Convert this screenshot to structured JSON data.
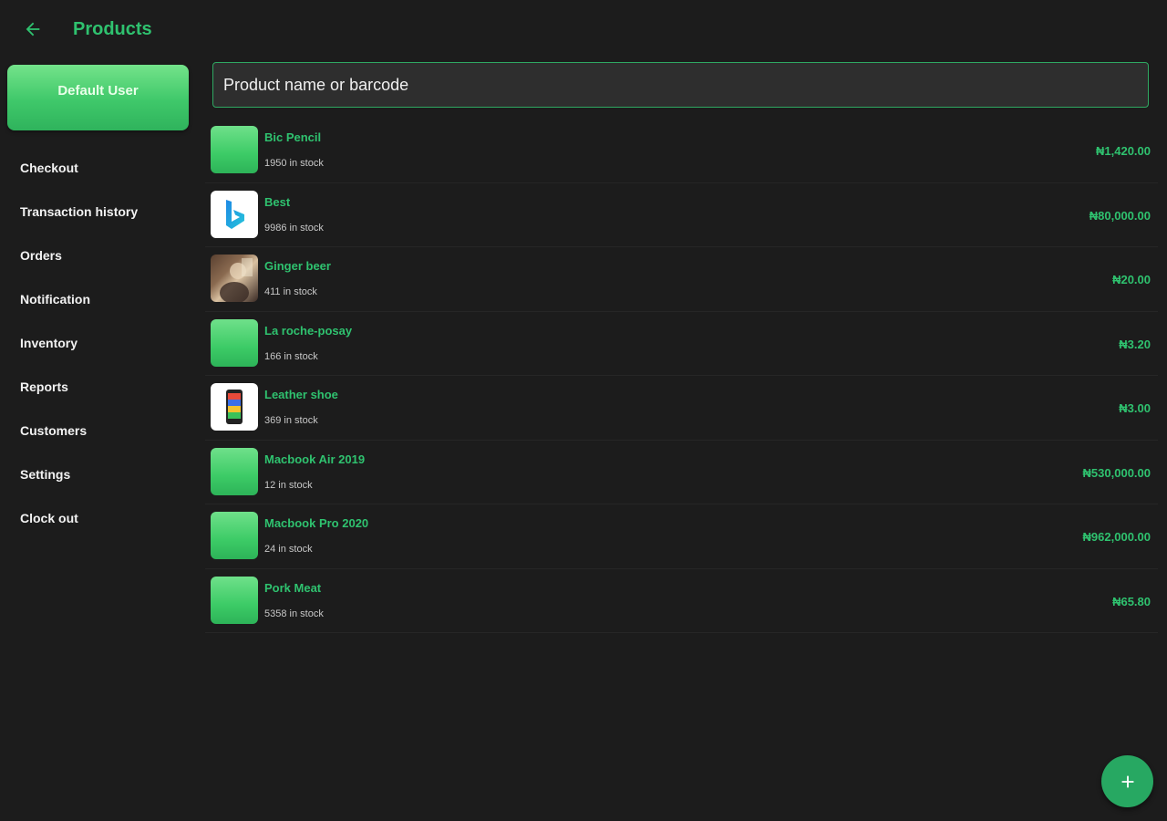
{
  "header": {
    "title": "Products",
    "back_icon": "arrow-left-icon",
    "accent_color": "#2fc26f"
  },
  "sidebar": {
    "user_label": "Default User",
    "items": [
      {
        "label": "Checkout"
      },
      {
        "label": "Transaction history"
      },
      {
        "label": "Orders"
      },
      {
        "label": "Notification"
      },
      {
        "label": "Inventory"
      },
      {
        "label": "Reports"
      },
      {
        "label": "Customers"
      },
      {
        "label": "Settings"
      },
      {
        "label": "Clock out"
      }
    ]
  },
  "search": {
    "placeholder": "Product name or barcode"
  },
  "products": [
    {
      "name": "Bic Pencil",
      "stock": "1950 in stock",
      "price": "₦1,420.00",
      "thumb": "green-placeholder"
    },
    {
      "name": "Best",
      "stock": "9986 in stock",
      "price": "₦80,000.00",
      "thumb": "bing-logo"
    },
    {
      "name": "Ginger beer",
      "stock": "411 in stock",
      "price": "₦20.00",
      "thumb": "photo"
    },
    {
      "name": "La roche-posay",
      "stock": "166 in stock",
      "price": "₦3.20",
      "thumb": "green-placeholder"
    },
    {
      "name": "Leather shoe",
      "stock": "369 in stock",
      "price": "₦3.00",
      "thumb": "phone-image"
    },
    {
      "name": "Macbook Air 2019",
      "stock": "12 in stock",
      "price": "₦530,000.00",
      "thumb": "green-placeholder"
    },
    {
      "name": "Macbook Pro 2020",
      "stock": "24 in stock",
      "price": "₦962,000.00",
      "thumb": "green-placeholder"
    },
    {
      "name": "Pork Meat",
      "stock": "5358 in stock",
      "price": "₦65.80",
      "thumb": "green-placeholder"
    }
  ],
  "fab": {
    "icon": "plus-icon"
  }
}
